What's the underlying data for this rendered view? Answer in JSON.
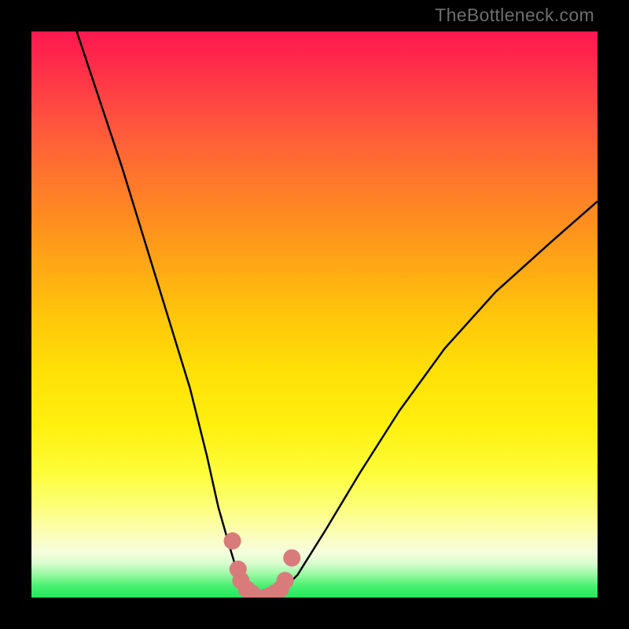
{
  "watermark": "TheBottleneck.com",
  "chart_data": {
    "type": "line",
    "title": "",
    "xlabel": "",
    "ylabel": "",
    "xlim": [
      0,
      100
    ],
    "ylim": [
      0,
      100
    ],
    "series": [
      {
        "name": "bottleneck-curve",
        "x": [
          8,
          12,
          16,
          20,
          24,
          28,
          31,
          33,
          35,
          36.5,
          38,
          40,
          42,
          44,
          47,
          52,
          58,
          65,
          73,
          82,
          92,
          100
        ],
        "values": [
          100,
          88,
          76,
          63,
          50,
          37,
          25,
          16,
          9,
          4,
          1,
          0,
          0,
          1,
          4,
          12,
          22,
          33,
          44,
          54,
          63,
          70
        ]
      }
    ],
    "markers": {
      "name": "highlighted-points",
      "x": [
        35.5,
        36.5,
        37,
        38,
        39,
        40,
        41,
        42,
        43,
        44,
        44.8,
        46
      ],
      "values": [
        10,
        5,
        3,
        1.5,
        0.7,
        0,
        0,
        0.3,
        0.8,
        1.5,
        3,
        7
      ],
      "color": "#d97b7b"
    },
    "background_gradient": [
      "#ff1850",
      "#ff8c20",
      "#fff010",
      "#20e85a"
    ]
  }
}
